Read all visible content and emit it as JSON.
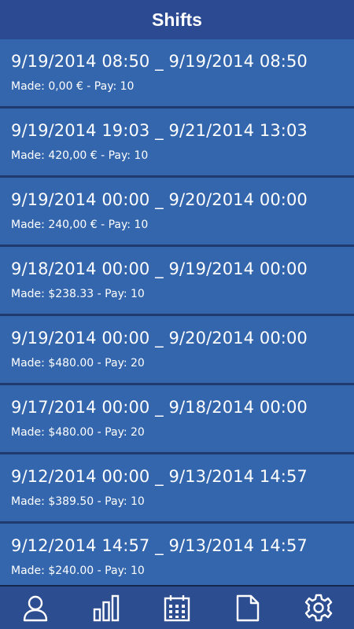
{
  "header": {
    "title": "Shifts"
  },
  "shifts": [
    {
      "range": "9/19/2014 08:50 _ 9/19/2014 08:50",
      "made": "Made: 0,00 € - Pay: 10"
    },
    {
      "range": "9/19/2014 19:03 _ 9/21/2014 13:03",
      "made": "Made: 420,00 € - Pay: 10"
    },
    {
      "range": "9/19/2014 00:00 _ 9/20/2014 00:00",
      "made": "Made: 240,00 € - Pay: 10"
    },
    {
      "range": "9/18/2014 00:00 _ 9/19/2014 00:00",
      "made": "Made: $238.33 - Pay: 10"
    },
    {
      "range": "9/19/2014 00:00 _ 9/20/2014 00:00",
      "made": "Made: $480.00 - Pay: 20"
    },
    {
      "range": "9/17/2014 00:00 _ 9/18/2014 00:00",
      "made": "Made: $480.00 - Pay: 20"
    },
    {
      "range": "9/12/2014 00:00 _ 9/13/2014 14:57",
      "made": "Made: $389.50 - Pay: 10"
    },
    {
      "range": "9/12/2014 14:57 _ 9/13/2014 14:57",
      "made": "Made: $240.00 - Pay: 10"
    }
  ],
  "tabbar": {
    "icons": [
      "person-icon",
      "bar-chart-icon",
      "calendar-icon",
      "document-icon",
      "gear-icon"
    ]
  },
  "colors": {
    "header": "#2b4a92",
    "row": "#3466ad",
    "tabbar": "#2c4d8f"
  }
}
